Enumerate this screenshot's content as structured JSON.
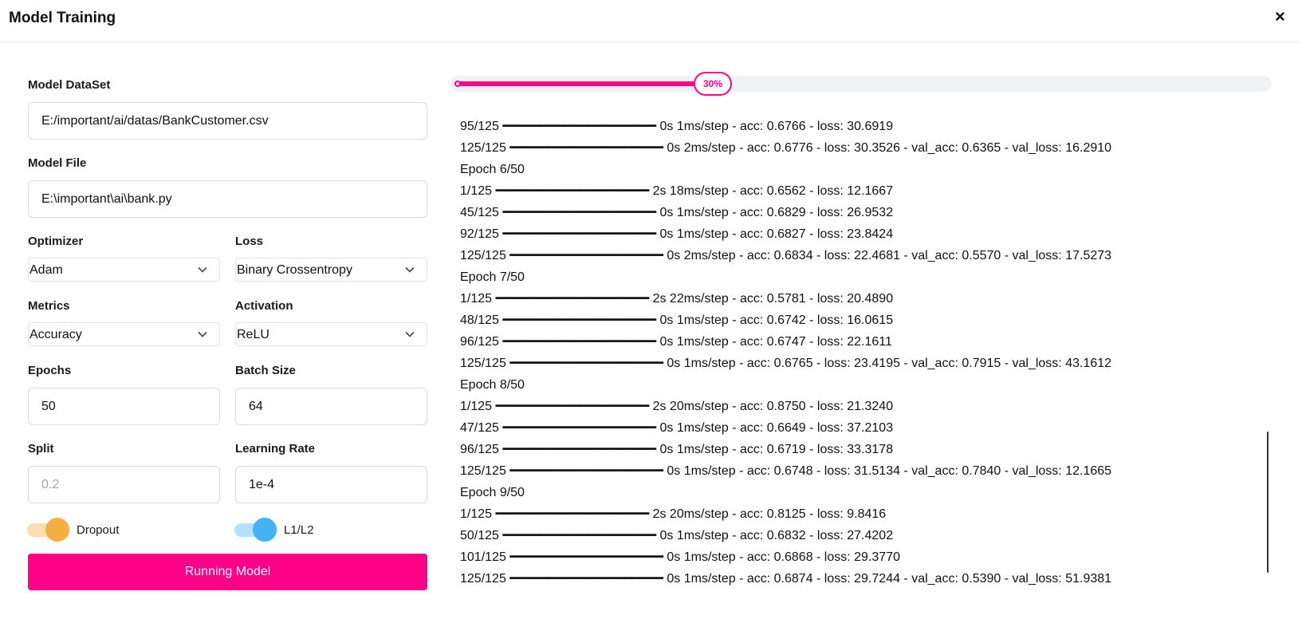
{
  "window": {
    "title": "Model Training",
    "close_label": "×"
  },
  "form": {
    "dataset": {
      "label": "Model DataSet",
      "value": "E:/important/ai/datas/BankCustomer.csv"
    },
    "model_file": {
      "label": "Model File",
      "value": "E:\\important\\ai\\bank.py"
    },
    "optimizer": {
      "label": "Optimizer",
      "value": "Adam"
    },
    "loss": {
      "label": "Loss",
      "value": "Binary Crossentropy"
    },
    "metrics": {
      "label": "Metrics",
      "value": "Accuracy"
    },
    "activation": {
      "label": "Activation",
      "value": "ReLU"
    },
    "epochs": {
      "label": "Epochs",
      "value": "50"
    },
    "batch_size": {
      "label": "Batch Size",
      "value": "64"
    },
    "split": {
      "label": "Split",
      "placeholder": "0.2"
    },
    "learning_rate": {
      "label": "Learning Rate",
      "value": "1e-4"
    },
    "dropout": {
      "label": "Dropout",
      "on": true,
      "color": "#f5b041"
    },
    "l1l2": {
      "label": "L1/L2",
      "on": true,
      "color": "#42b4f5"
    },
    "run_label": "Running Model"
  },
  "progress": {
    "percent": 30,
    "label": "30%",
    "color": "#ff0087"
  },
  "log": [
    "95/125 ━━━━━━━━━━━━━━━━━━━━ 0s 1ms/step - acc: 0.6766 - loss: 30.6919",
    "125/125 ━━━━━━━━━━━━━━━━━━━━ 0s 2ms/step - acc: 0.6776 - loss: 30.3526 - val_acc: 0.6365 - val_loss: 16.2910",
    "Epoch 6/50",
    "1/125 ━━━━━━━━━━━━━━━━━━━━ 2s 18ms/step - acc: 0.6562 - loss: 12.1667",
    "45/125 ━━━━━━━━━━━━━━━━━━━━ 0s 1ms/step - acc: 0.6829 - loss: 26.9532",
    "92/125 ━━━━━━━━━━━━━━━━━━━━ 0s 1ms/step - acc: 0.6827 - loss: 23.8424",
    "125/125 ━━━━━━━━━━━━━━━━━━━━ 0s 2ms/step - acc: 0.6834 - loss: 22.4681 - val_acc: 0.5570 - val_loss: 17.5273",
    "Epoch 7/50",
    "1/125 ━━━━━━━━━━━━━━━━━━━━ 2s 22ms/step - acc: 0.5781 - loss: 20.4890",
    "48/125 ━━━━━━━━━━━━━━━━━━━━ 0s 1ms/step - acc: 0.6742 - loss: 16.0615",
    "96/125 ━━━━━━━━━━━━━━━━━━━━ 0s 1ms/step - acc: 0.6747 - loss: 22.1611",
    "125/125 ━━━━━━━━━━━━━━━━━━━━ 0s 1ms/step - acc: 0.6765 - loss: 23.4195 - val_acc: 0.7915 - val_loss: 43.1612",
    "Epoch 8/50",
    "1/125 ━━━━━━━━━━━━━━━━━━━━ 2s 20ms/step - acc: 0.8750 - loss: 21.3240",
    "47/125 ━━━━━━━━━━━━━━━━━━━━ 0s 1ms/step - acc: 0.6649 - loss: 37.2103",
    "96/125 ━━━━━━━━━━━━━━━━━━━━ 0s 1ms/step - acc: 0.6719 - loss: 33.3178",
    "125/125 ━━━━━━━━━━━━━━━━━━━━ 0s 1ms/step - acc: 0.6748 - loss: 31.5134 - val_acc: 0.7840 - val_loss: 12.1665",
    "Epoch 9/50",
    "1/125 ━━━━━━━━━━━━━━━━━━━━ 2s 20ms/step - acc: 0.8125 - loss: 9.8416",
    "50/125 ━━━━━━━━━━━━━━━━━━━━ 0s 1ms/step - acc: 0.6832 - loss: 27.4202",
    "101/125 ━━━━━━━━━━━━━━━━━━━━ 0s 1ms/step - acc: 0.6868 - loss: 29.3770",
    "125/125 ━━━━━━━━━━━━━━━━━━━━ 0s 1ms/step - acc: 0.6874 - loss: 29.7244 - val_acc: 0.5390 - val_loss: 51.9381"
  ]
}
